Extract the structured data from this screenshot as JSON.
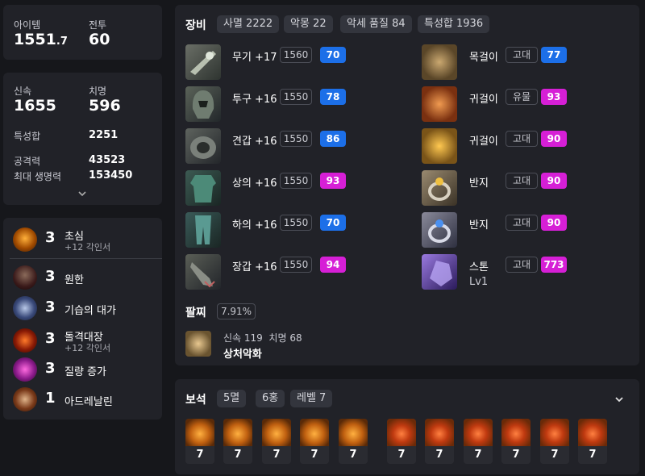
{
  "stats_top": {
    "item_label": "아이템",
    "item_value": "1551",
    "item_decimal": ".7",
    "battle_label": "전투",
    "battle_value": "60"
  },
  "stats_mid": {
    "swift_label": "신속",
    "swift_value": "1655",
    "crit_label": "치명",
    "crit_value": "596",
    "trait_sum_label": "특성합",
    "trait_sum_value": "2251",
    "attack_label": "공격력",
    "attack_value": "43523",
    "hp_label": "최대 생명력",
    "hp_value": "153450"
  },
  "engravings": [
    {
      "level": "3",
      "name": "초심",
      "sub": "+12 각인서",
      "icon": "engraving-beginner-icon"
    },
    {
      "level": "3",
      "name": "원한",
      "sub": "",
      "icon": "engraving-grudge-icon"
    },
    {
      "level": "3",
      "name": "기습의 대가",
      "sub": "",
      "icon": "engraving-ambush-icon"
    },
    {
      "level": "3",
      "name": "돌격대장",
      "sub": "+12 각인서",
      "icon": "engraving-raid-captain-icon"
    },
    {
      "level": "3",
      "name": "질량 증가",
      "sub": "",
      "icon": "engraving-mass-increase-icon"
    },
    {
      "level": "1",
      "name": "아드레날린",
      "sub": "",
      "icon": "engraving-adrenaline-icon"
    }
  ],
  "equipment": {
    "title": "장비",
    "tags": [
      "사멸 2222",
      "악몽 22",
      "악세 품질 84",
      "특성합 1936"
    ],
    "gear": [
      {
        "name": "무기 +17",
        "ilvl": "1560",
        "quality": "70",
        "color": "#1c6fe8",
        "icon": "weapon-icon"
      },
      {
        "name": "투구 +16",
        "ilvl": "1550",
        "quality": "78",
        "color": "#1c6fe8",
        "icon": "helmet-icon"
      },
      {
        "name": "견갑 +16",
        "ilvl": "1550",
        "quality": "86",
        "color": "#1c6fe8",
        "icon": "shoulder-icon"
      },
      {
        "name": "상의 +16",
        "ilvl": "1550",
        "quality": "93",
        "color": "#d61fd6",
        "icon": "chest-icon"
      },
      {
        "name": "하의 +16",
        "ilvl": "1550",
        "quality": "70",
        "color": "#1c6fe8",
        "icon": "pants-icon"
      },
      {
        "name": "장갑 +16",
        "ilvl": "1550",
        "quality": "94",
        "color": "#d61fd6",
        "icon": "gloves-icon"
      }
    ],
    "accessories": [
      {
        "name": "목걸이",
        "grade": "고대",
        "quality": "77",
        "color": "#1c6fe8",
        "icon": "necklace-icon"
      },
      {
        "name": "귀걸이",
        "grade": "유물",
        "quality": "93",
        "color": "#d61fd6",
        "icon": "earring-icon"
      },
      {
        "name": "귀걸이",
        "grade": "고대",
        "quality": "90",
        "color": "#d61fd6",
        "icon": "earring-icon"
      },
      {
        "name": "반지",
        "grade": "고대",
        "quality": "90",
        "color": "#d61fd6",
        "icon": "ring-icon"
      },
      {
        "name": "반지",
        "grade": "고대",
        "quality": "90",
        "color": "#d61fd6",
        "icon": "ring-icon"
      },
      {
        "name": "스톤",
        "grade": "고대",
        "quality": "773",
        "color": "#d61fd6",
        "icon": "ability-stone-icon",
        "sub": "Lv1"
      }
    ],
    "bracelet": {
      "title": "팔찌",
      "percent": "7.91%",
      "stats": "신속 119  치명 68",
      "effect": "상처악화"
    }
  },
  "gems": {
    "title": "보석",
    "tags": [
      "5멸",
      "6홍",
      "레벨 7"
    ],
    "items": [
      "7",
      "7",
      "7",
      "7",
      "7",
      "7",
      "7",
      "7",
      "7",
      "7",
      "7"
    ]
  }
}
